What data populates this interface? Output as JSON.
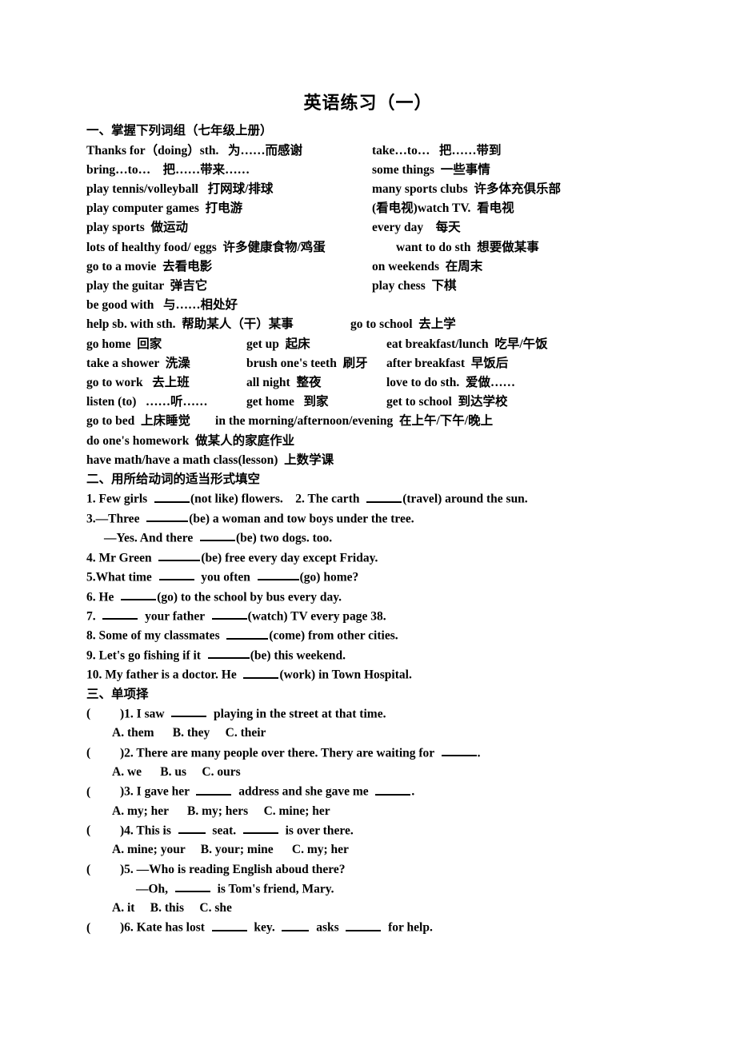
{
  "document": {
    "title": "英语练习（一）"
  },
  "section_one": {
    "heading": "一、掌握下列词组（七年级上册）",
    "rows": [
      {
        "type": "pair",
        "layout": "default",
        "left": "Thanks for（doing）sth.   为……而感谢",
        "right": "take…to…   把……带到"
      },
      {
        "type": "pair",
        "layout": "default",
        "left": "bring…to…    把……带来……",
        "right": "some things  一些事情"
      },
      {
        "type": "pair",
        "layout": "default",
        "left": "play tennis/volleyball   打网球/排球",
        "right": "many sports clubs  许多体充俱乐部"
      },
      {
        "type": "pair",
        "layout": "default",
        "left": "play computer games  打电游",
        "right": "(看电视)watch TV.  看电视"
      },
      {
        "type": "pair",
        "layout": "default",
        "left": "play sports  做运动",
        "right": "every day    每天"
      },
      {
        "type": "pair",
        "layout": "wide",
        "left": "lots of healthy food/ eggs  许多健康食物/鸡蛋",
        "right": "want to do sth  想要做某事"
      },
      {
        "type": "pair",
        "layout": "default",
        "left": "go to a movie  去看电影",
        "right": "on weekends  在周末"
      },
      {
        "type": "pair",
        "layout": "default",
        "left": "play the guitar  弹吉它",
        "right": "play chess  下棋"
      },
      {
        "type": "full",
        "text": "be good with   与……相处好"
      },
      {
        "type": "pair",
        "layout": "narrow",
        "left": "help sb. with sth.  帮助某人（干）某事",
        "right": "go to school  去上学"
      },
      {
        "type": "triple",
        "left": "go home  回家",
        "middle": "get up  起床",
        "right": "eat breakfast/lunch  吃早/午饭"
      },
      {
        "type": "triple",
        "left": "take a shower  洗澡",
        "middle": "brush one's teeth  刷牙",
        "right": "after breakfast  早饭后"
      },
      {
        "type": "triple",
        "left": "go to work   去上班",
        "middle": "all night  整夜",
        "right": "love to do sth.  爱做……"
      },
      {
        "type": "triple",
        "left": "listen (to)   ……听……",
        "middle": "get home   到家",
        "right": "get to school  到达学校"
      },
      {
        "type": "full",
        "text": "go to bed  上床睡觉        in the morning/afternoon/evening  在上午/下午/晚上"
      },
      {
        "type": "full",
        "text": "do one's homework  做某人的家庭作业"
      },
      {
        "type": "full",
        "text": "have math/have a math class(lesson)  上数学课"
      }
    ]
  },
  "section_two": {
    "heading": "二、用所给动词的适当形式填空",
    "items": [
      {
        "id": "q1",
        "indent": false,
        "parts": [
          "1. Few girls  ",
          "blank-md",
          "(not like) flowers.    2. The carth  ",
          "blank-md",
          "(travel) around the sun."
        ]
      },
      {
        "id": "q3",
        "indent": false,
        "parts": [
          "3.—Three  ",
          "blank-lg",
          "(be) a woman and tow boys under the tree."
        ]
      },
      {
        "id": "q3b",
        "indent": true,
        "parts": [
          "—Yes. And there  ",
          "blank-md",
          "(be) two dogs. too."
        ]
      },
      {
        "id": "q4",
        "indent": false,
        "parts": [
          "4. Mr Green  ",
          "blank-lg",
          "(be) free every day except Friday."
        ]
      },
      {
        "id": "q5",
        "indent": false,
        "parts": [
          "5.What time  ",
          "blank-md",
          "  you often  ",
          "blank-lg",
          "(go) home?"
        ]
      },
      {
        "id": "q6",
        "indent": false,
        "parts": [
          "6. He  ",
          "blank-md",
          "(go) to the school by bus every day."
        ]
      },
      {
        "id": "q7",
        "indent": false,
        "parts": [
          "7.  ",
          "blank-md",
          "  your father  ",
          "blank-md",
          "(watch) TV every page 38."
        ]
      },
      {
        "id": "q8",
        "indent": false,
        "parts": [
          "8. Some of my classmates  ",
          "blank-lg",
          "(come) from other cities."
        ]
      },
      {
        "id": "q9",
        "indent": false,
        "parts": [
          "9. Let's go fishing if it  ",
          "blank-lg",
          "(be) this weekend."
        ]
      },
      {
        "id": "q10",
        "indent": false,
        "parts": [
          "10. My father is a doctor. He  ",
          "blank-md",
          "(work) in Town Hospital."
        ]
      }
    ]
  },
  "section_three": {
    "heading": "三、单项择",
    "questions": [
      {
        "number": "1",
        "stem_parts": [
          ")1. I saw  ",
          "blank-md",
          "  playing in the street at that time."
        ],
        "options": "A. them      B. they     C. their",
        "second_line": null
      },
      {
        "number": "2",
        "stem_parts": [
          ")2. There are many people over there. Thery are waiting for  ",
          "blank-md",
          "."
        ],
        "options": "A. we      B. us     C. ours",
        "second_line": null
      },
      {
        "number": "3",
        "stem_parts": [
          ")3. I gave her  ",
          "blank-md",
          "  address and she gave me  ",
          "blank-md",
          "."
        ],
        "options": "A. my; her      B. my; hers     C. mine; her",
        "second_line": null
      },
      {
        "number": "4",
        "stem_parts": [
          ")4. This is  ",
          "blank-sm",
          "  seat.  ",
          "blank-md",
          "  is over there."
        ],
        "options": "A. mine; your     B. your; mine      C. my; her",
        "second_line": null
      },
      {
        "number": "5",
        "stem_parts": [
          ")5. —Who is reading English aboud there?"
        ],
        "options": "A. it     B. this     C. she",
        "second_line": [
          "—Oh,  ",
          "blank-md",
          "  is Tom's friend, Mary."
        ]
      },
      {
        "number": "6",
        "stem_parts": [
          ")6. Kate has lost  ",
          "blank-md",
          "  key.  ",
          "blank-sm",
          "  asks  ",
          "blank-md",
          "  for help."
        ],
        "options": null,
        "second_line": null
      }
    ],
    "open_paren": "("
  }
}
